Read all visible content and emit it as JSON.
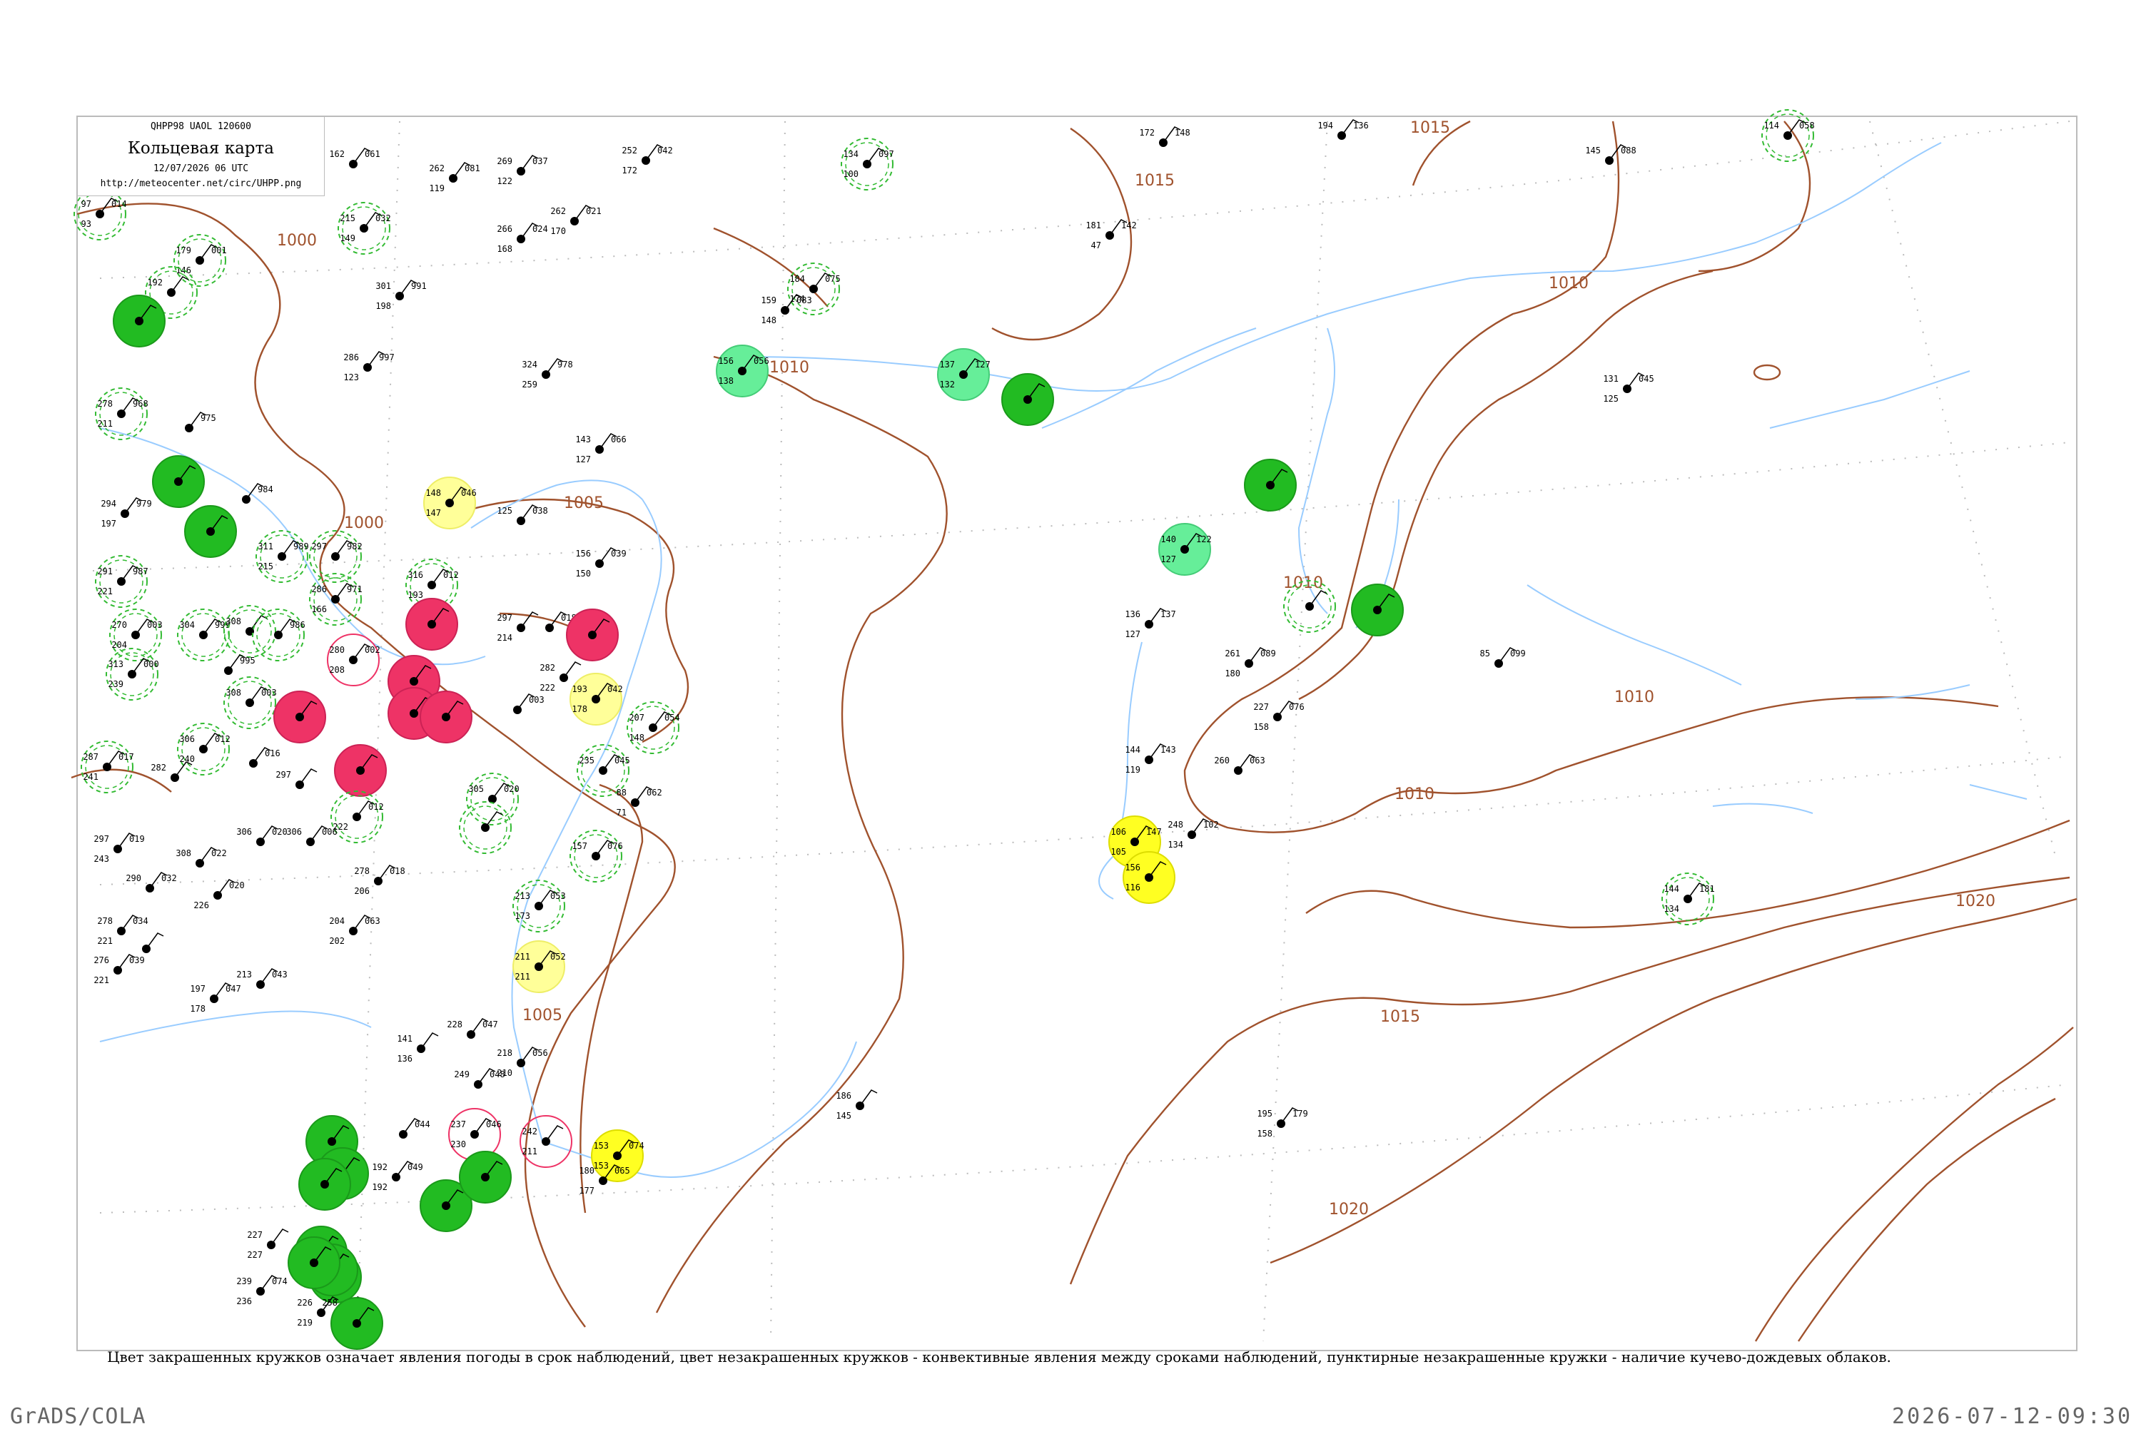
{
  "header": {
    "code_line": "QHPP98  UAOL  120600",
    "title": "Кольцевая карта",
    "date_line": "12/07/2026 06 UTC",
    "url_line": "http://meteocenter.net/circ/UHPP.png"
  },
  "caption": "Цвет закрашенных кружков означает явления погоды в срок наблюдений, цвет незакрашенных кружков - конвективные явления между сроками наблюдений, пунктирные незакрашенные кружки - наличие кучево-дождевых облаков.",
  "footer": {
    "left": "GrADS/COLA",
    "right": "2026-07-12-09:30"
  },
  "colors": {
    "green": "#22bb22",
    "light_green": "#66ee99",
    "red": "#ee3366",
    "yellow": "#ffff22",
    "pale_yellow": "#ffff99",
    "isobar": "#a0522d",
    "river": "#99ccff",
    "dashed_ring": "#33bb33"
  },
  "isobar_labels": [
    "1000",
    "1000",
    "1005",
    "1005",
    "1010",
    "1010",
    "1010",
    "1010",
    "1010",
    "1015",
    "1015",
    "1015",
    "1020",
    "1020"
  ],
  "stations": [
    {
      "t": "014",
      "p": "97",
      "d": "93",
      "name": "",
      "ring": "dashed"
    },
    {
      "t": "001",
      "p": "179",
      "d": "146",
      "name": "",
      "ring": "dashed"
    },
    {
      "t": "",
      "p": "192",
      "d": "",
      "name": "",
      "ring": "dashed"
    },
    {
      "t": "",
      "p": "",
      "d": "",
      "name": "",
      "ring": "green"
    },
    {
      "t": "061",
      "p": "162",
      "d": "",
      "name": "",
      "ring": "none"
    },
    {
      "t": "032",
      "p": "215",
      "d": "149",
      "name": "",
      "ring": "dashed"
    },
    {
      "t": "081",
      "p": "262",
      "d": "119",
      "name": "",
      "ring": "none"
    },
    {
      "t": "037",
      "p": "269",
      "d": "122",
      "name": "",
      "ring": "none"
    },
    {
      "t": "021",
      "p": "262",
      "d": "170",
      "name": "",
      "ring": "none"
    },
    {
      "t": "024",
      "p": "266",
      "d": "168",
      "name": "",
      "ring": "none"
    },
    {
      "t": "042",
      "p": "252",
      "d": "172",
      "name": "",
      "ring": "none"
    },
    {
      "t": "097",
      "p": "134",
      "d": "100",
      "name": "",
      "ring": "dashed"
    },
    {
      "t": "075",
      "p": "184",
      "d": "174",
      "name": "",
      "ring": "dashed"
    },
    {
      "t": "083",
      "p": "159",
      "d": "148",
      "name": "",
      "ring": "none"
    },
    {
      "t": "991",
      "p": "301",
      "d": "198",
      "name": "",
      "ring": "none"
    },
    {
      "t": "997",
      "p": "286",
      "d": "123",
      "name": "",
      "ring": "none"
    },
    {
      "t": "978",
      "p": "324",
      "d": "259",
      "name": "",
      "ring": "none"
    },
    {
      "t": "056",
      "p": "156",
      "d": "138",
      "name": "",
      "ring": "light_green"
    },
    {
      "t": "127",
      "p": "137",
      "d": "132",
      "name": "",
      "ring": "light_green"
    },
    {
      "t": "",
      "p": "",
      "d": "",
      "name": "",
      "ring": "green"
    },
    {
      "t": "148",
      "p": "172",
      "d": "",
      "name": "",
      "ring": "none"
    },
    {
      "t": "136",
      "p": "194",
      "d": "",
      "name": "",
      "ring": "none"
    },
    {
      "t": "088",
      "p": "145",
      "d": "",
      "name": "",
      "ring": "none"
    },
    {
      "t": "058",
      "p": "114",
      "d": "",
      "name": "",
      "ring": "dashed"
    },
    {
      "t": "142",
      "p": "181",
      "d": "47",
      "name": "",
      "ring": "none"
    },
    {
      "t": "968",
      "p": "278",
      "d": "211",
      "name": "",
      "ring": "dashed"
    },
    {
      "t": "975",
      "p": "",
      "d": "",
      "name": "",
      "ring": "none"
    },
    {
      "t": "",
      "p": "",
      "d": "",
      "name": "",
      "ring": "green"
    },
    {
      "t": "",
      "p": "",
      "d": "",
      "name": "",
      "ring": "green"
    },
    {
      "t": "066",
      "p": "143",
      "d": "127",
      "name": "",
      "ring": "none"
    },
    {
      "t": "046",
      "p": "148",
      "d": "147",
      "name": "",
      "ring": "pale_yellow"
    },
    {
      "t": "038",
      "p": "125",
      "d": "",
      "name": "",
      "ring": "none"
    },
    {
      "t": "039",
      "p": "156",
      "d": "150",
      "name": "",
      "ring": "none"
    },
    {
      "t": "045",
      "p": "131",
      "d": "125",
      "name": "",
      "ring": "none"
    },
    {
      "t": "",
      "p": "",
      "d": "",
      "name": "",
      "ring": "green"
    },
    {
      "t": "122",
      "p": "140",
      "d": "127",
      "name": "",
      "ring": "light_green"
    },
    {
      "t": "137",
      "p": "136",
      "d": "127",
      "name": "",
      "ring": "none"
    },
    {
      "t": "",
      "p": "",
      "d": "",
      "name": "",
      "ring": "dashed"
    },
    {
      "t": "",
      "p": "",
      "d": "",
      "name": "",
      "ring": "green"
    },
    {
      "t": "099",
      "p": "85",
      "d": "",
      "name": "",
      "ring": "none"
    },
    {
      "t": "089",
      "p": "261",
      "d": "180",
      "name": "",
      "ring": "none"
    },
    {
      "t": "076",
      "p": "227",
      "d": "158",
      "name": "",
      "ring": "none"
    },
    {
      "t": "979",
      "p": "294",
      "d": "197",
      "name": "",
      "ring": "none"
    },
    {
      "t": "984",
      "p": "",
      "d": "",
      "name": "",
      "ring": "none"
    },
    {
      "t": "989",
      "p": "311",
      "d": "215",
      "name": "",
      "ring": "dashed"
    },
    {
      "t": "982",
      "p": "297",
      "d": "",
      "name": "",
      "ring": "dashed"
    },
    {
      "t": "987",
      "p": "291",
      "d": "221",
      "name": "",
      "ring": "dashed"
    },
    {
      "t": "971",
      "p": "286",
      "d": "166",
      "name": "",
      "ring": "dashed"
    },
    {
      "t": "012",
      "p": "316",
      "d": "193",
      "name": "",
      "ring": "dashed"
    },
    {
      "t": "",
      "p": "",
      "d": "",
      "name": "",
      "ring": "red"
    },
    {
      "t": "",
      "p": "297",
      "d": "214",
      "name": "",
      "ring": "none"
    },
    {
      "t": "018",
      "p": "",
      "d": "",
      "name": "",
      "ring": "none"
    },
    {
      "t": "",
      "p": "",
      "d": "",
      "name": "",
      "ring": "red"
    },
    {
      "t": "003",
      "p": "270",
      "d": "204",
      "name": "",
      "ring": "dashed"
    },
    {
      "t": "999",
      "p": "304",
      "d": "",
      "name": "",
      "ring": "dashed"
    },
    {
      "t": "",
      "p": "308",
      "d": "",
      "name": "",
      "ring": "dashed"
    },
    {
      "t": "986",
      "p": "",
      "d": "",
      "name": "",
      "ring": "dashed"
    },
    {
      "t": "002",
      "p": "280",
      "d": "208",
      "name": "",
      "ring": "red_outline"
    },
    {
      "t": "",
      "p": "",
      "d": "",
      "name": "",
      "ring": "red"
    },
    {
      "t": "",
      "p": "282",
      "d": "222",
      "name": "",
      "ring": "none"
    },
    {
      "t": "042",
      "p": "193",
      "d": "178",
      "name": "",
      "ring": "pale_yellow"
    },
    {
      "t": "000",
      "p": "313",
      "d": "239",
      "name": "",
      "ring": "dashed"
    },
    {
      "t": "995",
      "p": "",
      "d": "",
      "name": "",
      "ring": "none"
    },
    {
      "t": "003",
      "p": "308",
      "d": "",
      "name": "",
      "ring": "dashed"
    },
    {
      "t": "",
      "p": "",
      "d": "",
      "name": "",
      "ring": "red"
    },
    {
      "t": "",
      "p": "",
      "d": "",
      "name": "",
      "ring": "red"
    },
    {
      "t": "",
      "p": "",
      "d": "",
      "name": "",
      "ring": "red"
    },
    {
      "t": "003",
      "p": "",
      "d": "",
      "name": "",
      "ring": "none"
    },
    {
      "t": "054",
      "p": "207",
      "d": "148",
      "name": "",
      "ring": "dashed"
    },
    {
      "t": "017",
      "p": "287",
      "d": "241",
      "name": "",
      "ring": "dashed"
    },
    {
      "t": "012",
      "p": "306",
      "d": "240",
      "name": "",
      "ring": "dashed"
    },
    {
      "t": "016",
      "p": "",
      "d": "",
      "name": "",
      "ring": "none"
    },
    {
      "t": "",
      "p": "",
      "d": "",
      "name": "",
      "ring": "red"
    },
    {
      "t": "045",
      "p": "235",
      "d": "",
      "name": "",
      "ring": "dashed"
    },
    {
      "t": "",
      "p": "282",
      "d": "",
      "name": "",
      "ring": "none"
    },
    {
      "t": "",
      "p": "297",
      "d": "",
      "name": "",
      "ring": "none"
    },
    {
      "t": "012",
      "p": "",
      "d": "222",
      "name": "",
      "ring": "dashed"
    },
    {
      "t": "020",
      "p": "305",
      "d": "",
      "name": "",
      "ring": "dashed"
    },
    {
      "t": "",
      "p": "",
      "d": "",
      "name": "",
      "ring": "dashed"
    },
    {
      "t": "062",
      "p": "88",
      "d": "71",
      "name": "",
      "ring": "none"
    },
    {
      "t": "019",
      "p": "297",
      "d": "243",
      "name": "",
      "ring": "none"
    },
    {
      "t": "022",
      "p": "308",
      "d": "",
      "name": "",
      "ring": "none"
    },
    {
      "t": "020",
      "p": "306",
      "d": "",
      "name": "",
      "ring": "none"
    },
    {
      "t": "006",
      "p": "306",
      "d": "",
      "name": "",
      "ring": "none"
    },
    {
      "t": "018",
      "p": "278",
      "d": "206",
      "name": "",
      "ring": "none"
    },
    {
      "t": "076",
      "p": "157",
      "d": "",
      "name": "",
      "ring": "dashed"
    },
    {
      "t": "032",
      "p": "290",
      "d": "",
      "name": "",
      "ring": "none"
    },
    {
      "t": "020",
      "p": "",
      "d": "226",
      "name": "",
      "ring": "none"
    },
    {
      "t": "053",
      "p": "213",
      "d": "173",
      "name": "",
      "ring": "dashed"
    },
    {
      "t": "034",
      "p": "278",
      "d": "221",
      "name": "",
      "ring": "none"
    },
    {
      "t": "",
      "p": "",
      "d": "",
      "name": "",
      "ring": "none"
    },
    {
      "t": "063",
      "p": "204",
      "d": "202",
      "name": "",
      "ring": "none"
    },
    {
      "t": "052",
      "p": "211",
      "d": "211",
      "name": "",
      "ring": "pale_yellow"
    },
    {
      "t": "039",
      "p": "276",
      "d": "221",
      "name": "",
      "ring": "none"
    },
    {
      "t": "043",
      "p": "213",
      "d": "",
      "name": "",
      "ring": "none"
    },
    {
      "t": "047",
      "p": "197",
      "d": "178",
      "name": "",
      "ring": "none"
    },
    {
      "t": "",
      "p": "141",
      "d": "136",
      "name": "",
      "ring": "none"
    },
    {
      "t": "047",
      "p": "228",
      "d": "",
      "name": "",
      "ring": "none"
    },
    {
      "t": "056",
      "p": "218",
      "d": "210",
      "name": "",
      "ring": "none"
    },
    {
      "t": "048",
      "p": "249",
      "d": "",
      "name": "",
      "ring": "none"
    },
    {
      "t": "046",
      "p": "237",
      "d": "230",
      "name": "",
      "ring": "red_outline"
    },
    {
      "t": "",
      "p": "242",
      "d": "211",
      "name": "",
      "ring": "red_outline"
    },
    {
      "t": "143",
      "p": "144",
      "d": "119",
      "name": "",
      "ring": "none"
    },
    {
      "t": "063",
      "p": "260",
      "d": "",
      "name": "",
      "ring": "none"
    },
    {
      "t": "147",
      "p": "106",
      "d": "105",
      "name": "",
      "ring": "yellow"
    },
    {
      "t": "102",
      "p": "248",
      "d": "134",
      "name": "",
      "ring": "none"
    },
    {
      "t": "",
      "p": "156",
      "d": "116",
      "name": "",
      "ring": "yellow"
    },
    {
      "t": "181",
      "p": "144",
      "d": "134",
      "name": "",
      "ring": "dashed"
    },
    {
      "t": "",
      "p": "",
      "d": "",
      "name": "",
      "ring": "green"
    },
    {
      "t": "044",
      "p": "",
      "d": "",
      "name": "",
      "ring": "none"
    },
    {
      "t": "049",
      "p": "192",
      "d": "192",
      "name": "",
      "ring": "none"
    },
    {
      "t": "",
      "p": "",
      "d": "",
      "name": "",
      "ring": "green"
    },
    {
      "t": "",
      "p": "",
      "d": "",
      "name": "",
      "ring": "green"
    },
    {
      "t": "",
      "p": "",
      "d": "",
      "name": "",
      "ring": "green"
    },
    {
      "t": "",
      "p": "",
      "d": "",
      "name": "",
      "ring": "green"
    },
    {
      "t": "074",
      "p": "153",
      "d": "153",
      "name": "",
      "ring": "yellow"
    },
    {
      "t": "065",
      "p": "180",
      "d": "177",
      "name": "",
      "ring": "none"
    },
    {
      "t": "",
      "p": "186",
      "d": "145",
      "name": "",
      "ring": "none"
    },
    {
      "t": "179",
      "p": "195",
      "d": "158",
      "name": "",
      "ring": "none"
    },
    {
      "t": "",
      "p": "227",
      "d": "227",
      "name": "",
      "ring": "none"
    },
    {
      "t": "",
      "p": "",
      "d": "",
      "name": "",
      "ring": "green"
    },
    {
      "t": "",
      "p": "",
      "d": "",
      "name": "",
      "ring": "green"
    },
    {
      "t": "074",
      "p": "239",
      "d": "236",
      "name": "",
      "ring": "none"
    },
    {
      "t": "",
      "p": "226",
      "d": "219",
      "name": "",
      "ring": "none"
    },
    {
      "t": "",
      "p": "258",
      "d": "",
      "name": "",
      "ring": "none"
    },
    {
      "t": "",
      "p": "",
      "d": "",
      "name": "",
      "ring": "green"
    },
    {
      "t": "",
      "p": "",
      "d": "",
      "name": "",
      "ring": "green"
    },
    {
      "t": "",
      "p": "",
      "d": "",
      "name": "",
      "ring": "green"
    }
  ]
}
